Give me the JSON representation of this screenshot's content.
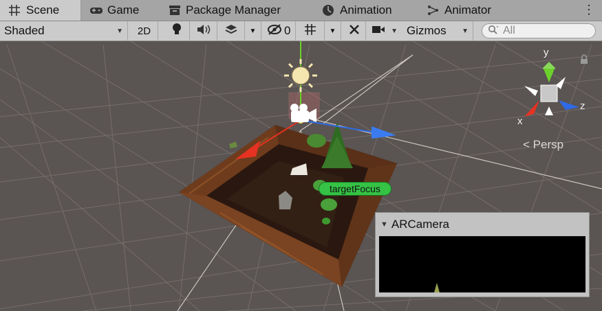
{
  "tabs": [
    {
      "label": "Scene",
      "icon": "grid-icon",
      "active": true
    },
    {
      "label": "Game",
      "icon": "gamepad-icon",
      "active": false
    },
    {
      "label": "Package Manager",
      "icon": "package-icon",
      "active": false
    },
    {
      "label": "Animation",
      "icon": "clock-icon",
      "active": false
    },
    {
      "label": "Animator",
      "icon": "animator-icon",
      "active": false
    }
  ],
  "toolbar": {
    "draw_mode": "Shaded",
    "mode_2d": "2D",
    "hidden_count": "0",
    "gizmos": "Gizmos",
    "search_placeholder": "All"
  },
  "scene": {
    "orientation": {
      "y": "y",
      "x": "x",
      "z": "z"
    },
    "persp": "Persp",
    "target_label": "targetFocus"
  },
  "camera_preview": {
    "title": "ARCamera"
  },
  "colors": {
    "tab_bar": "#a5a5a5",
    "active_tab": "#cbcbcb",
    "scene_background": "#5a5452",
    "grid_line": "#7d7673",
    "target_label_bg": "#35c245",
    "axis_x": "#e53222",
    "axis_y": "#6bd12a",
    "axis_z": "#2f6ae6"
  }
}
